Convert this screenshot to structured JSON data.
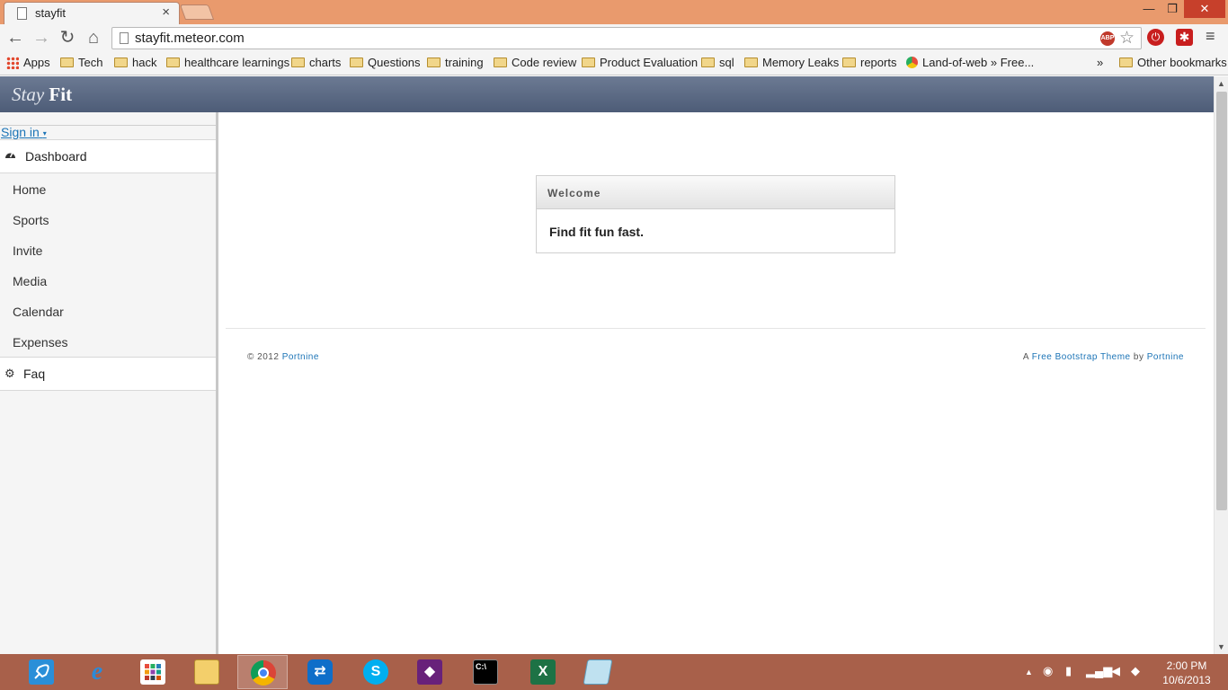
{
  "browser": {
    "tab_title": "stayfit",
    "tab_close": "×",
    "window_controls": {
      "minimize": "—",
      "maximize": "❐",
      "close": "✕"
    },
    "nav": {
      "back": "←",
      "forward": "→",
      "reload": "↻",
      "home": "⌂"
    },
    "url": "stayfit.meteor.com",
    "abp_label": "ABP",
    "star": "☆",
    "ext_power": "⏻",
    "ext_red": "✱",
    "menu": "≡"
  },
  "bookmarks": {
    "items": [
      "Apps",
      "Tech",
      "hack",
      "healthcare learnings",
      "charts",
      "Questions",
      "training",
      "Code review",
      "Product Evaluation",
      "sql",
      "Memory Leaks",
      "reports",
      "Land-of-web » Free..."
    ],
    "more": "»",
    "other": "Other bookmarks"
  },
  "site": {
    "brand_stay": "Stay",
    "brand_fit": "Fit",
    "signin": "Sign in",
    "signin_caret": "▾",
    "sidebar": {
      "dashboard_icon": "dashboard-icon",
      "dashboard": "Dashboard",
      "items": [
        "Home",
        "Sports",
        "Invite",
        "Media",
        "Calendar",
        "Expenses"
      ],
      "faq_icon": "gear-icon",
      "faq": "Faq"
    },
    "widget": {
      "title": "Welcome",
      "body": "Find fit fun fast."
    },
    "footer": {
      "copyright": "© 2012",
      "portnine": "Portnine",
      "right_prefix": "A",
      "theme_link": "Free Bootstrap Theme",
      "right_by": "by",
      "right_link": "Portnine"
    }
  },
  "taskbar": {
    "apps": [
      "rocket-icon",
      "internet-explorer-icon",
      "start-apps-icon",
      "file-explorer-icon",
      "chrome-icon",
      "teamviewer-icon",
      "skype-icon",
      "visual-studio-icon",
      "command-prompt-icon",
      "excel-icon",
      "notepad-icon"
    ],
    "glyphs": {
      "ie": "e",
      "skype": "S",
      "vs": "◆",
      "cmd": "C:\\",
      "excel": "X"
    },
    "tray_arrow": "▲",
    "time": "2:00 PM",
    "date": "10/6/2013"
  },
  "colors": {
    "tabstrip": "#e99a6d",
    "header_top": "#6c7a93",
    "link": "#1a73b6",
    "taskbar": "#a8604a"
  }
}
